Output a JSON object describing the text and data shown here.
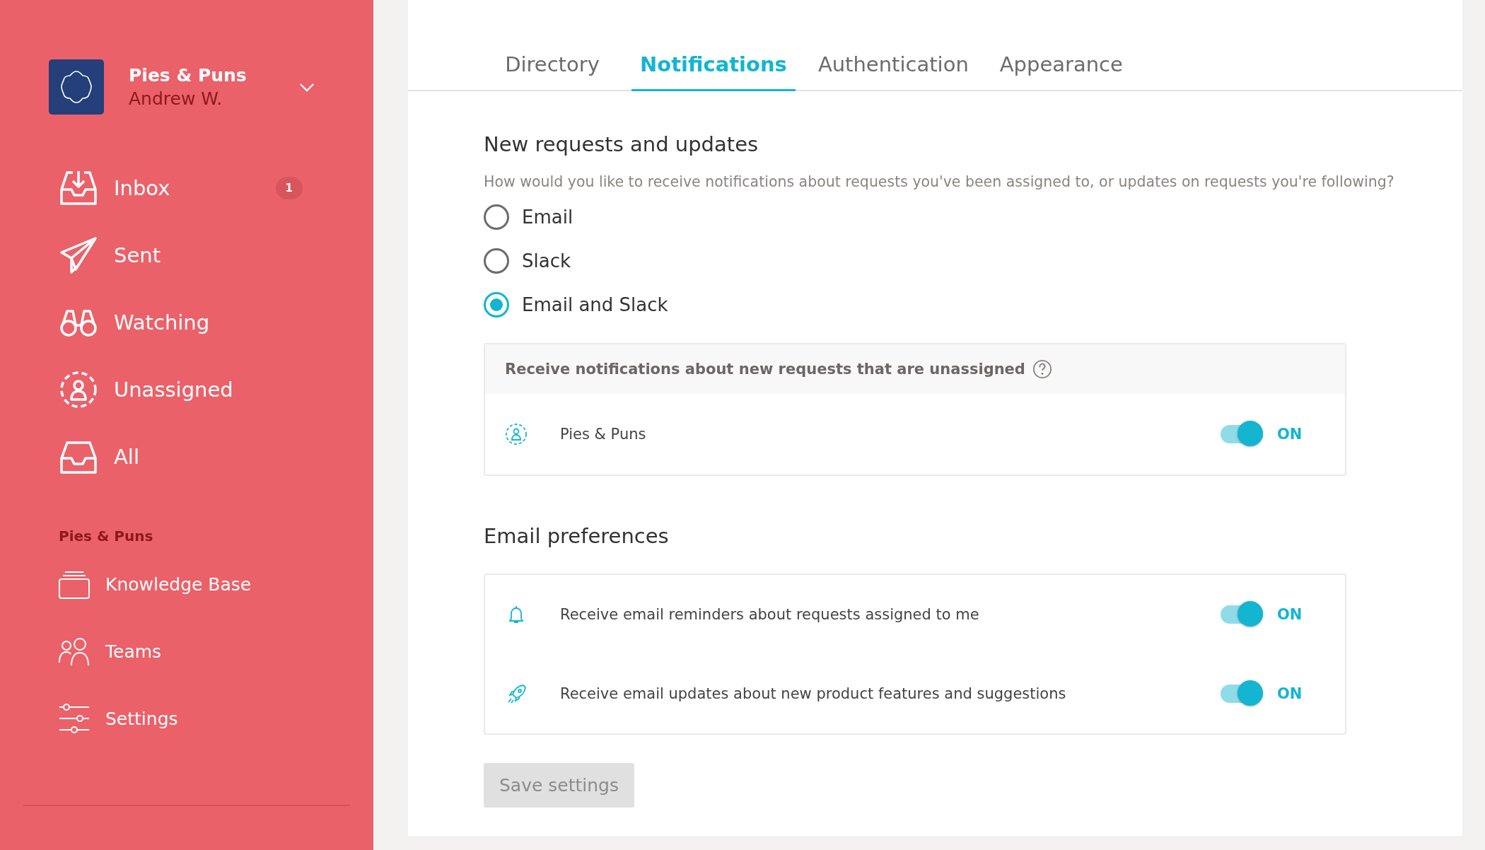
{
  "workspace": {
    "name": "Pies & Puns",
    "user": "Andrew W."
  },
  "nav": [
    {
      "kind": "inbox",
      "label": "Inbox",
      "badge": "1"
    },
    {
      "kind": "sent",
      "label": "Sent"
    },
    {
      "kind": "watching",
      "label": "Watching"
    },
    {
      "kind": "unassigned",
      "label": "Unassigned"
    },
    {
      "kind": "all",
      "label": "All"
    }
  ],
  "section_label": "Pies & Puns",
  "section_nav": [
    {
      "kind": "knowledge",
      "label": "Knowledge Base"
    },
    {
      "kind": "teams",
      "label": "Teams"
    },
    {
      "kind": "settings",
      "label": "Settings"
    }
  ],
  "tabs": [
    {
      "label": "Directory",
      "selected": false
    },
    {
      "label": "Notifications",
      "selected": true
    },
    {
      "label": "Authentication",
      "selected": false
    },
    {
      "label": "Appearance",
      "selected": false
    }
  ],
  "requests": {
    "heading": "New requests and updates",
    "description": "How would you like to receive notifications about requests you've been assigned to, or updates on requests you're following?",
    "options": [
      {
        "label": "Email",
        "selected": false
      },
      {
        "label": "Slack",
        "selected": false
      },
      {
        "label": "Email and Slack",
        "selected": true
      }
    ],
    "unassigned_panel": {
      "title": "Receive notifications about new requests that are unassigned",
      "rows": [
        {
          "kind": "person",
          "label": "Pies & Puns",
          "on": true,
          "state": "ON"
        }
      ]
    }
  },
  "email": {
    "heading": "Email preferences",
    "rows": [
      {
        "kind": "bell",
        "label": "Receive email reminders about requests assigned to me",
        "on": true,
        "state": "ON"
      },
      {
        "kind": "rocket",
        "label": "Receive email updates about new product features and suggestions",
        "on": true,
        "state": "ON"
      }
    ]
  },
  "save_button": {
    "label": "Save settings",
    "disabled": true
  }
}
